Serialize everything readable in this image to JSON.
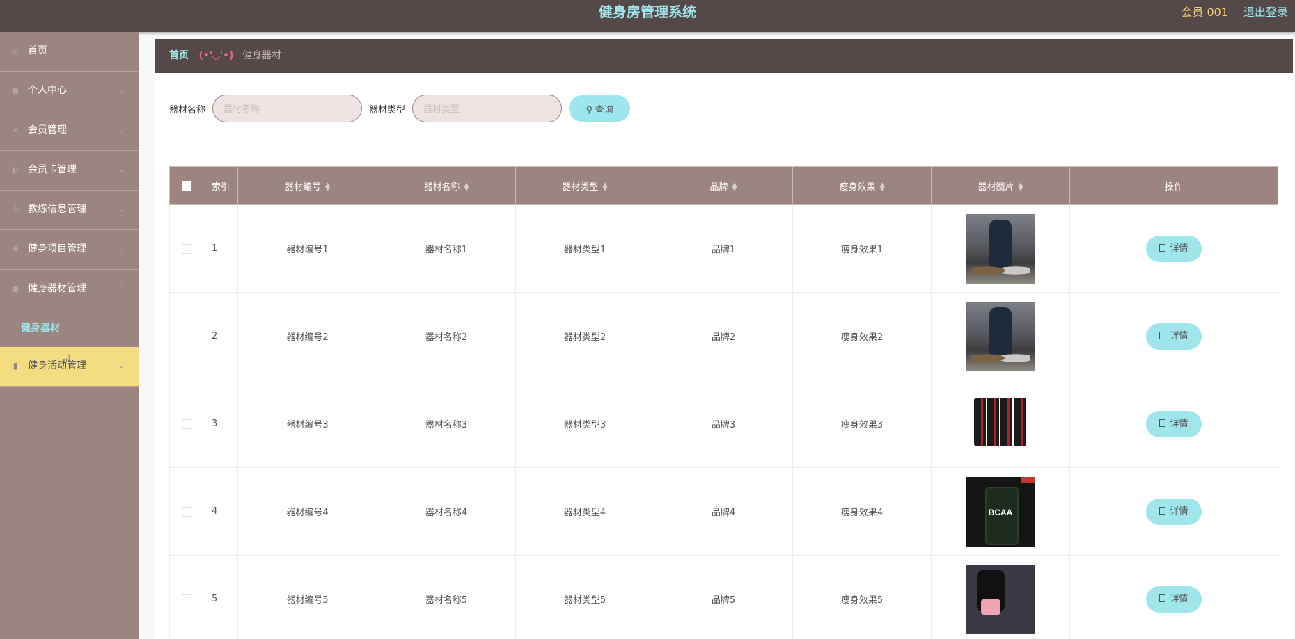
{
  "header": {
    "title": "健身房管理系统",
    "user": "会员 001",
    "logout": "退出登录"
  },
  "sidebar": {
    "items": [
      {
        "label": "首页",
        "icon": "home-icon",
        "has_chevron": false
      },
      {
        "label": "个人中心",
        "icon": "user-icon",
        "has_chevron": true
      },
      {
        "label": "会员管理",
        "icon": "member-icon",
        "has_chevron": true
      },
      {
        "label": "会员卡管理",
        "icon": "card-icon",
        "has_chevron": true
      },
      {
        "label": "教练信息管理",
        "icon": "coach-icon",
        "has_chevron": true
      },
      {
        "label": "健身项目管理",
        "icon": "project-icon",
        "has_chevron": true
      },
      {
        "label": "健身器材管理",
        "icon": "equipment-icon",
        "has_chevron": true
      }
    ],
    "subitem": "健身器材",
    "active_item": {
      "label": "健身活动管理",
      "icon": "activity-icon",
      "has_chevron": true
    }
  },
  "breadcrumb": {
    "home": "首页",
    "separator": "(•'◡'•)",
    "current": "健身器材"
  },
  "search": {
    "name_label": "器材名称",
    "name_placeholder": "器材名称",
    "type_label": "器材类型",
    "type_placeholder": "器材类型",
    "query_button": "查询"
  },
  "table": {
    "columns": [
      "索引",
      "器材编号",
      "器材名称",
      "器材类型",
      "品牌",
      "瘦身效果",
      "器材图片",
      "操作"
    ],
    "detail_label": "详情",
    "rows": [
      {
        "index": "1",
        "code": "器材编号1",
        "name": "器材名称1",
        "type": "器材类型1",
        "brand": "品牌1",
        "effect": "瘦身效果1",
        "image": "photo1"
      },
      {
        "index": "2",
        "code": "器材编号2",
        "name": "器材名称2",
        "type": "器材类型2",
        "brand": "品牌2",
        "effect": "瘦身效果2",
        "image": "photo1"
      },
      {
        "index": "3",
        "code": "器材编号3",
        "name": "器材名称3",
        "type": "器材类型3",
        "brand": "品牌3",
        "effect": "瘦身效果3",
        "image": "cans"
      },
      {
        "index": "4",
        "code": "器材编号4",
        "name": "器材名称4",
        "type": "器材类型4",
        "brand": "品牌4",
        "effect": "瘦身效果4",
        "image": "bcaa",
        "image_text": "BCAA"
      },
      {
        "index": "5",
        "code": "器材编号5",
        "name": "器材名称5",
        "type": "器材类型5",
        "brand": "品牌5",
        "effect": "瘦身效果5",
        "image": "suit"
      }
    ]
  },
  "colors": {
    "header_bg": "#554848",
    "sidebar_bg": "#9c8580",
    "accent": "#9ee6ec",
    "active_menu": "#f3dd80",
    "user_text": "#f0d070"
  }
}
